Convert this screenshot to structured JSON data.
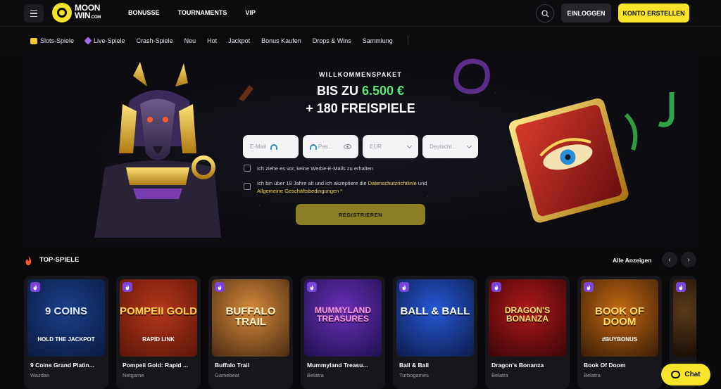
{
  "header": {
    "logo_line1": "MOON",
    "logo_line2": "WIN",
    "logo_com": ".COM",
    "nav": [
      "BONUSSE",
      "TOURNAMENTS",
      "VIP"
    ],
    "login_label": "EINLOGGEN",
    "register_label": "KONTO ERSTELLEN"
  },
  "categories": [
    {
      "label": "Slots-Spiele",
      "icon": "slots-icon",
      "color": "#f4c932"
    },
    {
      "label": "Live-Spiele",
      "icon": "live-icon",
      "color": "#a067f0"
    },
    {
      "label": "Crash-Spiele"
    },
    {
      "label": "Neu"
    },
    {
      "label": "Hot"
    },
    {
      "label": "Jackpot"
    },
    {
      "label": "Bonus Kaufen"
    },
    {
      "label": "Drops & Wins"
    },
    {
      "label": "Sammlung"
    }
  ],
  "hero": {
    "subtitle": "WILLKOMMENSPAKET",
    "line1_prefix": "BIS ZU ",
    "line1_amount": "6.500 €",
    "line2": "+ 180 FREISPIELE",
    "email_placeholder": "E-Mail",
    "password_placeholder": "Pas...",
    "currency_value": "EUR",
    "country_value": "Deutschl...",
    "checkbox1_text": "Ich ziehe es vor, keine Werbe-E-Mails zu erhalten",
    "checkbox2_text_a": "Ich bin über 18 Jahre alt und ich akzeptiere die ",
    "checkbox2_link1": "Datenschutzrichtlinie",
    "checkbox2_text_b": " und ",
    "checkbox2_link2": "Allgemeine Geschäftsbedingungen",
    "checkbox2_star": " *",
    "register_label": "REGISTRIEREN"
  },
  "top_games": {
    "title": "TOP-SPIELE",
    "view_all": "Alle Anzeigen",
    "games": [
      {
        "name": "9 Coins Grand Platin...",
        "provider": "Wazdan",
        "art_text": "9 COINS",
        "art_sub": "HOLD THE JACKPOT",
        "bg1": "#1b3f8a",
        "bg2": "#0b1a40",
        "fg": "#dfe8ff"
      },
      {
        "name": "Pompeii Gold: Rapid ...",
        "provider": "Netgame",
        "art_text": "POMPEII GOLD",
        "art_sub": "RAPID LINK",
        "bg1": "#b8361a",
        "bg2": "#5a1608",
        "fg": "#ffd44a"
      },
      {
        "name": "Buffalo Trail",
        "provider": "Gamebeat",
        "art_text": "BUFFALO TRAIL",
        "art_sub": "",
        "bg1": "#d78a3a",
        "bg2": "#4a2b12",
        "fg": "#fff2c6"
      },
      {
        "name": "Mummyland Treasu...",
        "provider": "Belatra",
        "art_text": "MUMMYLAND TREASURES",
        "art_sub": "",
        "bg1": "#6b2fb8",
        "bg2": "#1e1050",
        "fg": "#ff9be0"
      },
      {
        "name": "Ball & Ball",
        "provider": "Turbogames",
        "art_text": "BALL & BALL",
        "art_sub": "",
        "bg1": "#2459d6",
        "bg2": "#0e1a4a",
        "fg": "#ffffff"
      },
      {
        "name": "Dragon's Bonanza",
        "provider": "Belatra",
        "art_text": "DRAGON'S BONANZA",
        "art_sub": "",
        "bg1": "#b0171a",
        "bg2": "#3a0608",
        "fg": "#ffe37a"
      },
      {
        "name": "Book Of Doom",
        "provider": "Belatra",
        "art_text": "BOOK OF DOOM",
        "art_sub": "#BUYBONUS",
        "bg1": "#c46a12",
        "bg2": "#3a1c06",
        "fg": "#ffdc6a"
      },
      {
        "name": "",
        "provider": "",
        "art_text": "",
        "art_sub": "",
        "bg1": "#5a3a1a",
        "bg2": "#1a0e06",
        "fg": "#ffd"
      }
    ]
  },
  "chat_label": "Chat",
  "colors": {
    "accent": "#f7e42a",
    "green": "#5fe37a",
    "purple_badge": "#7b44d9"
  }
}
